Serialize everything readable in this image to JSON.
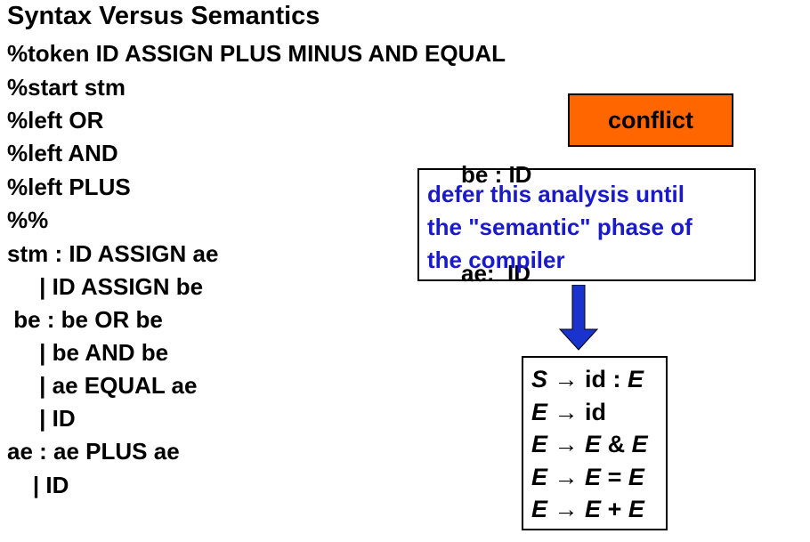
{
  "slide": {
    "title": "Syntax Versus Semantics"
  },
  "grammar": {
    "lines": [
      "%token ID ASSIGN PLUS MINUS AND EQUAL",
      "%start stm",
      "%left OR",
      "%left AND",
      "%left PLUS",
      "%%",
      "stm : ID ASSIGN ae",
      "     | ID ASSIGN be",
      " be : be OR be",
      "     | be AND be",
      "     | ae EQUAL ae",
      "     | ID",
      "ae : ae PLUS ae",
      "    | ID"
    ]
  },
  "rules": {
    "be_line": "be : ID",
    "ae_line": "ae:  ID"
  },
  "conflict": {
    "label": "conflict",
    "color": "#ff6600"
  },
  "note": {
    "lines": [
      "defer this analysis until",
      "the \"semantic\" phase of",
      "the compiler"
    ],
    "color": "#1a1acc"
  },
  "arrow": {
    "icon": "down-arrow-icon",
    "color": "#1a33cc"
  },
  "productions": {
    "arrow_symbol": "→",
    "items": [
      {
        "lhs": "S",
        "rhs": [
          {
            "t": "id : ",
            "i": false
          },
          {
            "t": "E",
            "i": true
          }
        ]
      },
      {
        "lhs": "E",
        "rhs": [
          {
            "t": "id",
            "i": false
          }
        ]
      },
      {
        "lhs": "E",
        "rhs": [
          {
            "t": "E",
            "i": true
          },
          {
            "t": " & ",
            "i": false
          },
          {
            "t": "E",
            "i": true
          }
        ]
      },
      {
        "lhs": "E",
        "rhs": [
          {
            "t": "E",
            "i": true
          },
          {
            "t": " = ",
            "i": false
          },
          {
            "t": "E",
            "i": true
          }
        ]
      },
      {
        "lhs": "E",
        "rhs": [
          {
            "t": "E",
            "i": true
          },
          {
            "t": " + ",
            "i": false
          },
          {
            "t": "E",
            "i": true
          }
        ]
      }
    ]
  }
}
